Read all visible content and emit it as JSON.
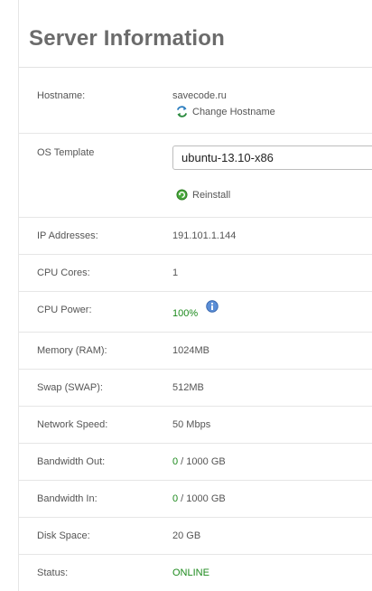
{
  "title": "Server Information",
  "hostname": {
    "label": "Hostname:",
    "value": "savecode.ru",
    "action": "Change Hostname"
  },
  "os_template": {
    "label": "OS Template",
    "selected": "ubuntu-13.10-x86",
    "action": "Reinstall"
  },
  "ip": {
    "label": "IP Addresses:",
    "value": "191.101.1.144"
  },
  "cpu_cores": {
    "label": "CPU Cores:",
    "value": "1"
  },
  "cpu_power": {
    "label": "CPU Power:",
    "value": "100%"
  },
  "memory": {
    "label": "Memory (RAM):",
    "value": "1024MB"
  },
  "swap": {
    "label": "Swap (SWAP):",
    "value": "512MB"
  },
  "network": {
    "label": "Network Speed:",
    "value": "50 Mbps"
  },
  "bandwidth_out": {
    "label": "Bandwidth Out:",
    "used": "0",
    "total": " / 1000 GB"
  },
  "bandwidth_in": {
    "label": "Bandwidth In:",
    "used": "0",
    "total": " / 1000 GB"
  },
  "disk": {
    "label": "Disk Space:",
    "value": "20 GB"
  },
  "status": {
    "label": "Status:",
    "value": "ONLINE"
  },
  "colors": {
    "green": "#1d8a1d",
    "title": "#6b6b6b",
    "info_blue": "#3b6fc4"
  }
}
